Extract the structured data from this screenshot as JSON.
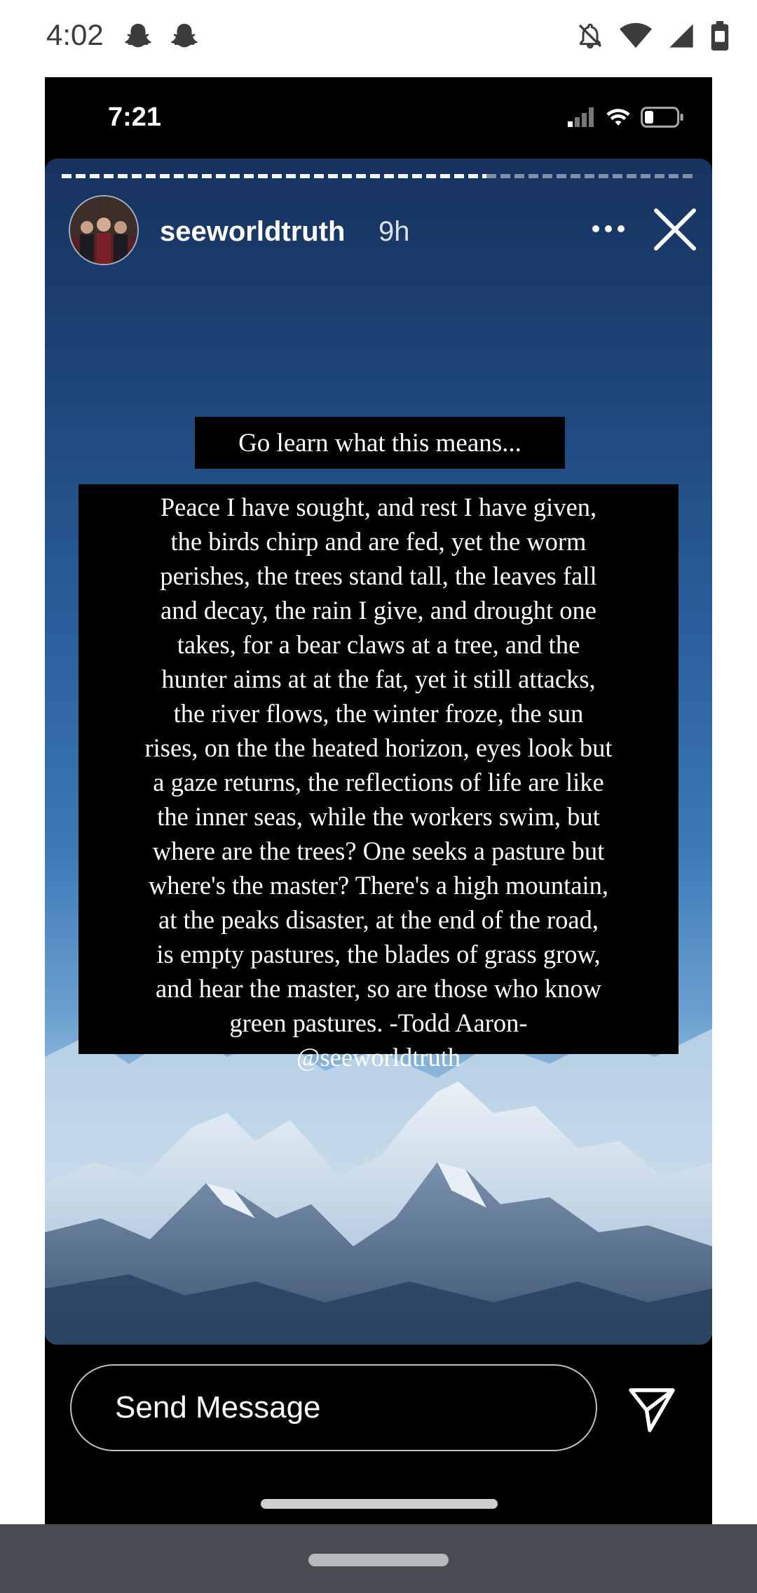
{
  "system_status": {
    "time": "4:02",
    "icons": [
      "snapchat-ghost-icon",
      "snapchat-ghost-icon",
      "notifications-off-icon",
      "wifi-icon",
      "signal-icon",
      "battery-icon"
    ]
  },
  "inner_status": {
    "time": "7:21",
    "icons": [
      "signal-icon",
      "wifi-icon",
      "battery-icon"
    ]
  },
  "story": {
    "progress_fraction": 0.67,
    "username": "seeworldtruth",
    "time_ago": "9h",
    "caption": "Go learn what this means...",
    "poem_lines": [
      "Peace I have sought, and rest I have given,",
      "the birds chirp and are fed, yet the worm",
      "perishes, the trees stand tall, the leaves fall",
      "and decay, the rain I give, and drought one",
      "takes, for a bear claws at a tree, and the",
      "hunter aims at at the fat, yet it still attacks,",
      "the river flows, the winter froze, the sun",
      "rises, on the the heated horizon, eyes look but",
      "a gaze returns, the reflections of life are like",
      "the inner seas, while the workers swim, but",
      "where are the trees? One seeks a pasture but",
      "where's the master? There's a high mountain,",
      "at the peaks disaster, at the end of the road,",
      "is empty pastures, the blades of grass grow,",
      "and hear the master, so are those who know",
      "green pastures.  -Todd Aaron-",
      "@seeworldtruth"
    ]
  },
  "reply": {
    "placeholder": "Send Message"
  },
  "colors": {
    "nav_bar": "#474b52",
    "story_top": "#17325e",
    "story_bottom": "#d8e6f1"
  }
}
